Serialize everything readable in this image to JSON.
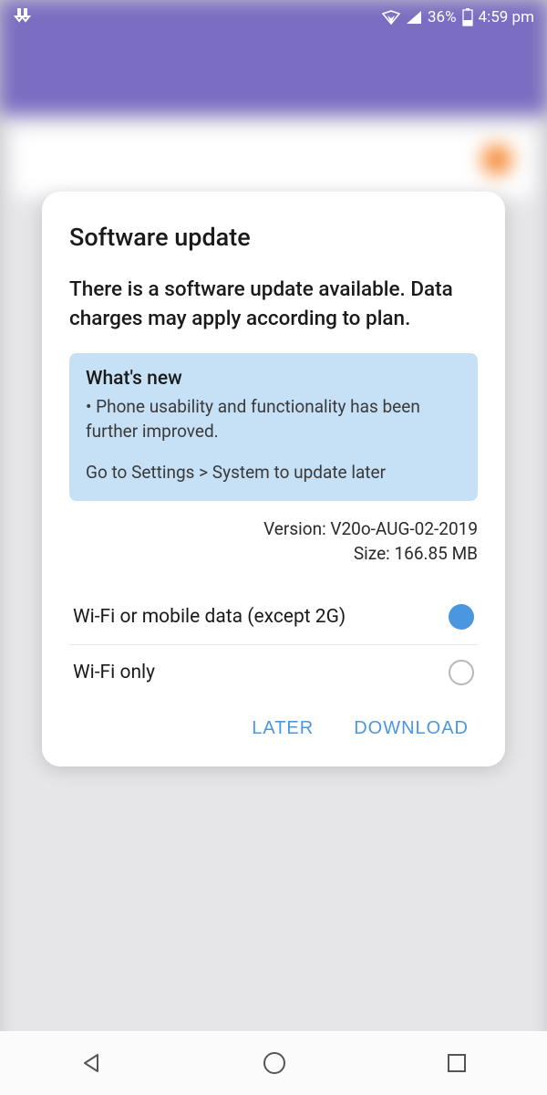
{
  "status": {
    "battery_pct": "36%",
    "time": "4:59 pm"
  },
  "dialog": {
    "title": "Software update",
    "message": "There is a software update available. Data charges may apply according to plan.",
    "whats_new": {
      "heading": "What's new",
      "item": "• Phone usability and functionality has been further improved.",
      "hint": "Go to Settings > System to update later"
    },
    "version_label": "Version: V20o-AUG-02-2019",
    "size_label": "Size: 166.85 MB",
    "options": [
      {
        "label": "Wi-Fi or mobile data (except 2G)",
        "selected": true
      },
      {
        "label": "Wi-Fi only",
        "selected": false
      }
    ],
    "buttons": {
      "later": "LATER",
      "download": "DOWNLOAD"
    }
  }
}
